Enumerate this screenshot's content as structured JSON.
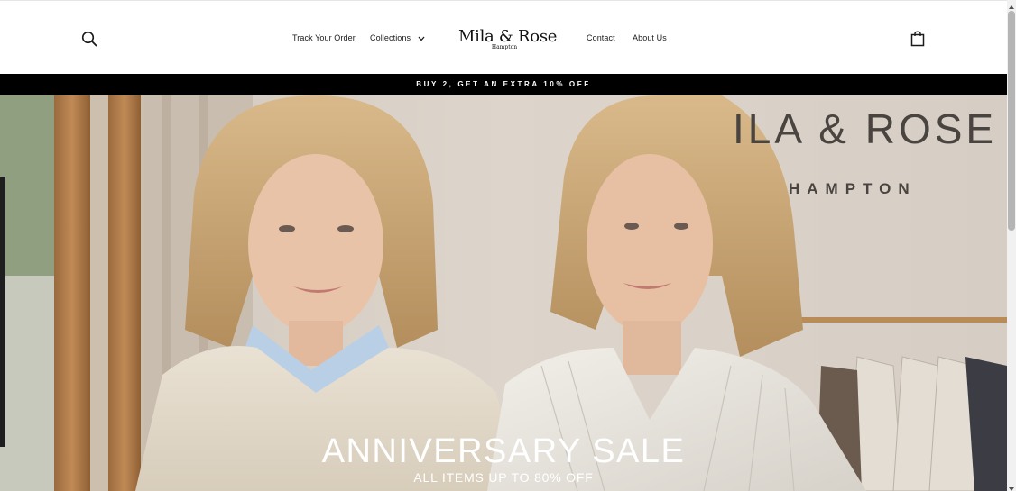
{
  "header": {
    "nav": {
      "track_order": "Track Your Order",
      "collections": "Collections",
      "contact": "Contact",
      "about": "About Us"
    },
    "logo": {
      "main": "Mila & Rose",
      "sub": "Hampton"
    },
    "icons": {
      "search": "search-icon",
      "cart": "shopping-bag-icon",
      "collections_caret": "chevron-down-icon"
    }
  },
  "announcement": {
    "text": "BUY 2, GET AN EXTRA 10% OFF"
  },
  "hero": {
    "wall_brand": "ILA & ROSE",
    "wall_sub": "HAMPTON",
    "title": "ANNIVERSARY SALE",
    "subtitle": "ALL ITEMS UP TO 80% OFF"
  },
  "colors": {
    "announcement_bg": "#000000",
    "announcement_text": "#ffffff",
    "header_bg": "#ffffff",
    "hero_text": "#ffffff"
  }
}
